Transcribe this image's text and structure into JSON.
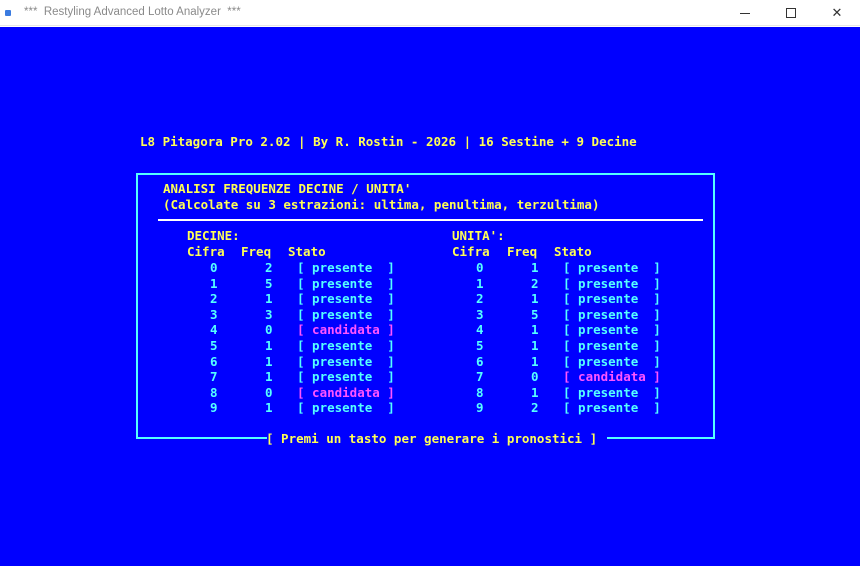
{
  "window": {
    "title": "***  Restyling Advanced Lotto Analyzer  ***",
    "buttons": [
      "minimize",
      "maximize",
      "close"
    ],
    "close_glyph": "✕"
  },
  "console": {
    "background": "#0000ff",
    "header": "L8 Pitagora Pro 2.02 | By R. Rostin - 2026 | 16 Sestine + 9 Decine",
    "panel": {
      "title": "ANALISI FREQUENZE DECINE / UNITA'",
      "subtitle": "(Calcolate su 3 estrazioni: ultima, penultima, terzultima)",
      "footer": "[ Premi un tasto per generare i pronostici ]",
      "decine": {
        "label": "DECINE:",
        "headers": [
          "Cifra",
          "Freq",
          "Stato"
        ],
        "rows": [
          {
            "cifra": "0",
            "freq": "2",
            "stato": "[ presente  ]"
          },
          {
            "cifra": "1",
            "freq": "5",
            "stato": "[ presente  ]"
          },
          {
            "cifra": "2",
            "freq": "1",
            "stato": "[ presente  ]"
          },
          {
            "cifra": "3",
            "freq": "3",
            "stato": "[ presente  ]"
          },
          {
            "cifra": "4",
            "freq": "0",
            "stato": "[ candidata ]"
          },
          {
            "cifra": "5",
            "freq": "1",
            "stato": "[ presente  ]"
          },
          {
            "cifra": "6",
            "freq": "1",
            "stato": "[ presente  ]"
          },
          {
            "cifra": "7",
            "freq": "1",
            "stato": "[ presente  ]"
          },
          {
            "cifra": "8",
            "freq": "0",
            "stato": "[ candidata ]"
          },
          {
            "cifra": "9",
            "freq": "1",
            "stato": "[ presente  ]"
          }
        ]
      },
      "unita": {
        "label": "UNITA':",
        "headers": [
          "Cifra",
          "Freq",
          "Stato"
        ],
        "rows": [
          {
            "cifra": "0",
            "freq": "1",
            "stato": "[ presente  ]"
          },
          {
            "cifra": "1",
            "freq": "2",
            "stato": "[ presente  ]"
          },
          {
            "cifra": "2",
            "freq": "1",
            "stato": "[ presente  ]"
          },
          {
            "cifra": "3",
            "freq": "5",
            "stato": "[ presente  ]"
          },
          {
            "cifra": "4",
            "freq": "1",
            "stato": "[ presente  ]"
          },
          {
            "cifra": "5",
            "freq": "1",
            "stato": "[ presente  ]"
          },
          {
            "cifra": "6",
            "freq": "1",
            "stato": "[ presente  ]"
          },
          {
            "cifra": "7",
            "freq": "0",
            "stato": "[ candidata ]"
          },
          {
            "cifra": "8",
            "freq": "1",
            "stato": "[ presente  ]"
          },
          {
            "cifra": "9",
            "freq": "2",
            "stato": "[ presente  ]"
          }
        ]
      }
    }
  }
}
